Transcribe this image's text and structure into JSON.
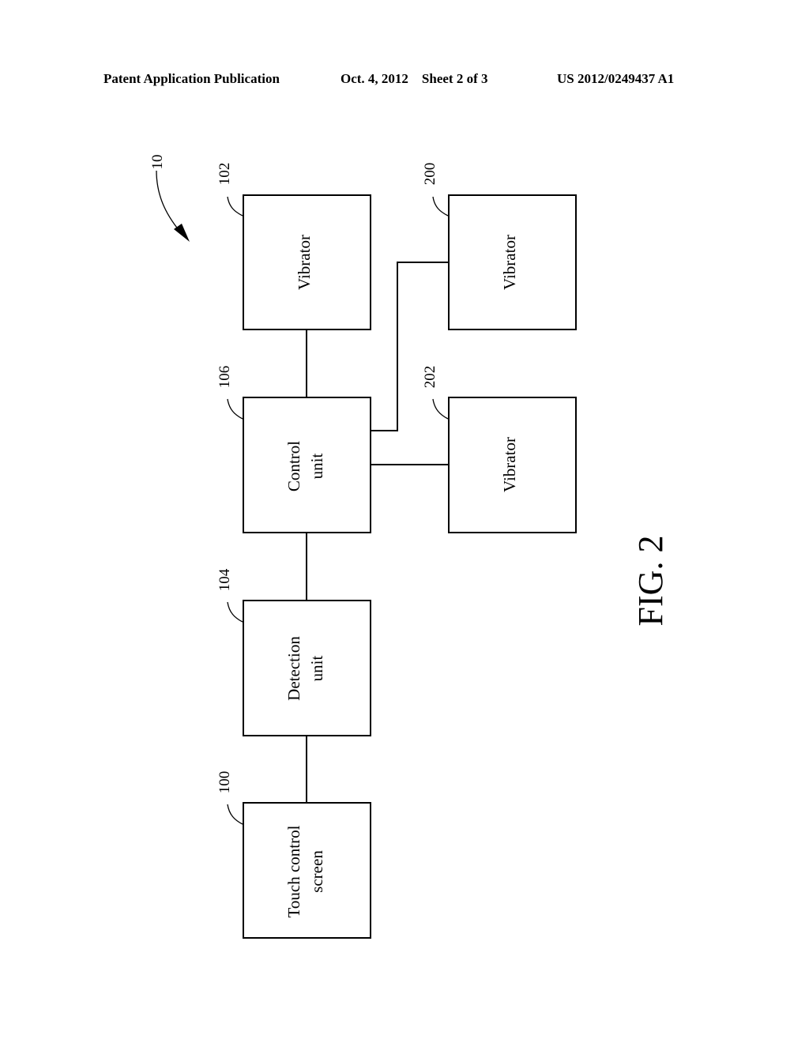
{
  "header": {
    "left": "Patent Application Publication",
    "center": "Oct. 4, 2012    Sheet 2 of 3",
    "right": "US 2012/0249437 A1"
  },
  "figure": {
    "caption": "FIG. 2",
    "system_ref": "10",
    "blocks": [
      {
        "id": "vibrator_102",
        "ref": "102",
        "lines": [
          "Vibrator"
        ]
      },
      {
        "id": "control_106",
        "ref": "106",
        "lines": [
          "Control",
          "unit"
        ]
      },
      {
        "id": "detection_104",
        "ref": "104",
        "lines": [
          "Detection",
          "unit"
        ]
      },
      {
        "id": "touch_100",
        "ref": "100",
        "lines": [
          "Touch control",
          "screen"
        ]
      },
      {
        "id": "vibrator_200",
        "ref": "200",
        "lines": [
          "Vibrator"
        ]
      },
      {
        "id": "vibrator_202",
        "ref": "202",
        "lines": [
          "Vibrator"
        ]
      }
    ],
    "connections": [
      [
        "vibrator_102",
        "control_106"
      ],
      [
        "control_106",
        "detection_104"
      ],
      [
        "detection_104",
        "touch_100"
      ],
      [
        "control_106",
        "vibrator_200"
      ],
      [
        "control_106",
        "vibrator_202"
      ]
    ]
  }
}
